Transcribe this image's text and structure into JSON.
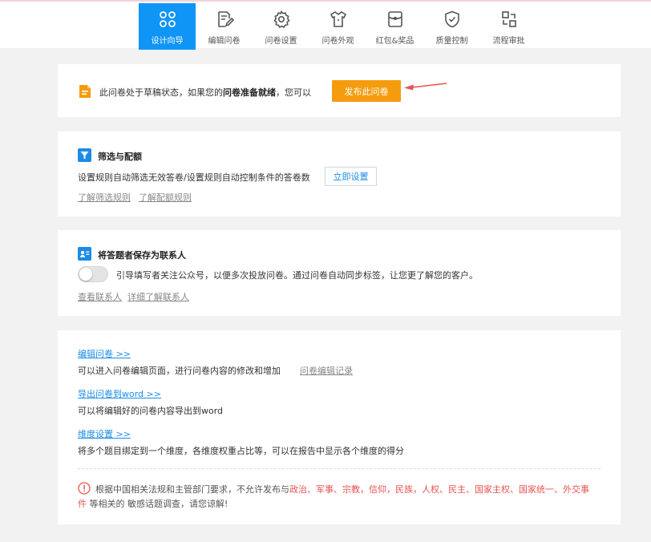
{
  "nav": [
    {
      "label": "设计向导",
      "icon": "grid-icon",
      "active": true
    },
    {
      "label": "编辑问卷",
      "icon": "edit-icon",
      "active": false
    },
    {
      "label": "问卷设置",
      "icon": "gear-icon",
      "active": false
    },
    {
      "label": "问卷外观",
      "icon": "shirt-icon",
      "active": false
    },
    {
      "label": "红包&奖品",
      "icon": "giftbag-icon",
      "active": false
    },
    {
      "label": "质量控制",
      "icon": "shield-check-icon",
      "active": false
    },
    {
      "label": "流程审批",
      "icon": "workflow-icon",
      "active": false
    }
  ],
  "draft": {
    "text_before": "此问卷处于草稿状态，如果您的",
    "text_bold": "问卷准备就绪",
    "text_after": "，您可以",
    "publish_label": "发布此问卷"
  },
  "filter": {
    "title": "筛选与配额",
    "desc": "设置规则自动筛选无效答卷/设置规则自动控制条件的答卷数",
    "setup_label": "立即设置",
    "link1": "了解筛选规则",
    "link2": "了解配额规则"
  },
  "contact": {
    "title": "将答题者保存为联系人",
    "toggle_on": false,
    "desc": "引导填写者关注公众号，以便多次投放问卷。通过问卷自动同步标签，让您更了解您的客户。",
    "link1": "查看联系人",
    "link2": "详细了解联系人"
  },
  "actions": {
    "edit_link": "编辑问卷 >>",
    "edit_desc": "可以进入问卷编辑页面，进行问卷内容的修改和增加",
    "edit_record": "问卷编辑记录",
    "export_link": "导出问卷到word >>",
    "export_desc": "可以将编辑好的问卷内容导出到word",
    "dimension_link": "维度设置 >>",
    "dimension_desc": "将多个题目绑定到一个维度，各维度权重占比等，可以在报告中显示各个维度的得分"
  },
  "notice": {
    "prefix": "根据中国相关法规和主管部门要求，不允许发布与",
    "sensitive": "政治、军事、宗教，信仰，民族，人权、民主、国家主权、国家统一、外交事件",
    "suffix": "等相关的 敏感话题调查，请您谅解!"
  },
  "colors": {
    "accent": "#0f95f5",
    "publish": "#f59c0e",
    "warning": "#e8534f",
    "link": "#1a8ce8"
  }
}
